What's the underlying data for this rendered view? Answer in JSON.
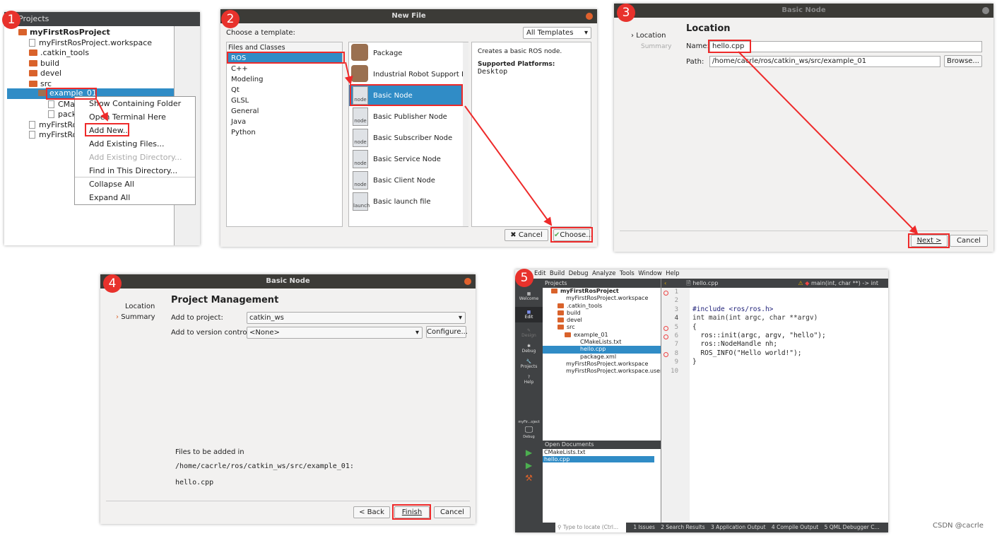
{
  "steps": [
    "1",
    "2",
    "3",
    "4",
    "5"
  ],
  "p1": {
    "header": "Projects",
    "tree": [
      "myFirstRosProject",
      "myFirstRosProject.workspace",
      ".catkin_tools",
      "build",
      "devel",
      "src",
      "example_01",
      "CMa",
      "pack",
      "myFirstRo",
      "myFirstRo"
    ],
    "menu": [
      "Show Containing Folder",
      "Open Terminal Here",
      "Add New...",
      "Add Existing Files...",
      "Add Existing Directory...",
      "Find in This Directory...",
      "Collapse All",
      "Expand All"
    ]
  },
  "p2": {
    "title": "New File",
    "choose_label": "Choose a template:",
    "filter": "All Templates",
    "categories_header": "Files and Classes",
    "categories": [
      "ROS",
      "C++",
      "Modeling",
      "Qt",
      "GLSL",
      "General",
      "Java",
      "Python"
    ],
    "templates": [
      {
        "label": "Package",
        "icon": ""
      },
      {
        "label": "Industrial Robot Support Packa",
        "icon": ""
      },
      {
        "label": "Basic Node",
        "icon": "node"
      },
      {
        "label": "Basic Publisher Node",
        "icon": "node"
      },
      {
        "label": "Basic Subscriber Node",
        "icon": "node"
      },
      {
        "label": "Basic Service Node",
        "icon": "node"
      },
      {
        "label": "Basic Client Node",
        "icon": "node"
      },
      {
        "label": "Basic launch file",
        "icon": "launch"
      }
    ],
    "description": "Creates a basic ROS node.",
    "platforms_label": "Supported Platforms:",
    "platforms": "Desktop",
    "cancel": "Cancel",
    "choose": "Choose..."
  },
  "p3": {
    "title": "Basic Node",
    "steps": [
      "Location",
      "Summary"
    ],
    "heading": "Location",
    "name_label": "Name:",
    "name_value": "hello.cpp",
    "path_label": "Path:",
    "path_value": "/home/cacrle/ros/catkin_ws/src/example_01",
    "browse": "Browse...",
    "next": "Next >",
    "cancel": "Cancel"
  },
  "p4": {
    "title": "Basic Node",
    "steps": [
      "Location",
      "Summary"
    ],
    "heading": "Project Management",
    "project_label": "Add to project:",
    "project_value": "catkin_ws",
    "vc_label": "Add to version control:",
    "vc_value": "<None>",
    "configure": "Configure...",
    "files_label": "Files to be added in",
    "files_path": "/home/cacrle/ros/catkin_ws/src/example_01:",
    "file": "hello.cpp",
    "back": "< Back",
    "finish": "Finish",
    "cancel": "Cancel"
  },
  "p5": {
    "menu": [
      "Edit",
      "Build",
      "Debug",
      "Analyze",
      "Tools",
      "Window",
      "Help"
    ],
    "modes": [
      "Welcome",
      "Edit",
      "Design",
      "Debug",
      "Projects",
      "Help"
    ],
    "kit": "myFir...oject",
    "kit_mode": "Debug",
    "projects_header": "Projects",
    "tree": [
      "myFirstRosProject",
      "myFirstRosProject.workspace",
      ".catkin_tools",
      "build",
      "devel",
      "src",
      "example_01",
      "CMakeLists.txt",
      "hello.cpp",
      "package.xml",
      "myFirstRosProject.workspace",
      "myFirstRosProject.workspace.user"
    ],
    "open_docs_header": "Open Documents",
    "open_docs": [
      "CMakeLists.txt",
      "hello.cpp"
    ],
    "editor_file": "hello.cpp",
    "function": "main(int, char **) -> int",
    "lines": [
      "1",
      "2",
      "3",
      "4",
      "5",
      "6",
      "7",
      "8",
      "9",
      "10"
    ],
    "code": [
      "#include <ros/ros.h>",
      "",
      "int main(int argc, char **argv)",
      "{",
      "  ros::init(argc, argv, \"hello\");",
      "  ros::NodeHandle nh;",
      "",
      "  ROS_INFO(\"Hello world!\");",
      "}",
      ""
    ],
    "locator": "Type to locate (Ctrl...",
    "outputs": [
      "1  Issues",
      "2  Search Results",
      "3  Application Output",
      "4  Compile Output",
      "5  QML Debugger C..."
    ]
  },
  "watermark": "CSDN @cacrle",
  "colors": {
    "selection": "#308cc6",
    "annotation": "#ee2a2a"
  }
}
